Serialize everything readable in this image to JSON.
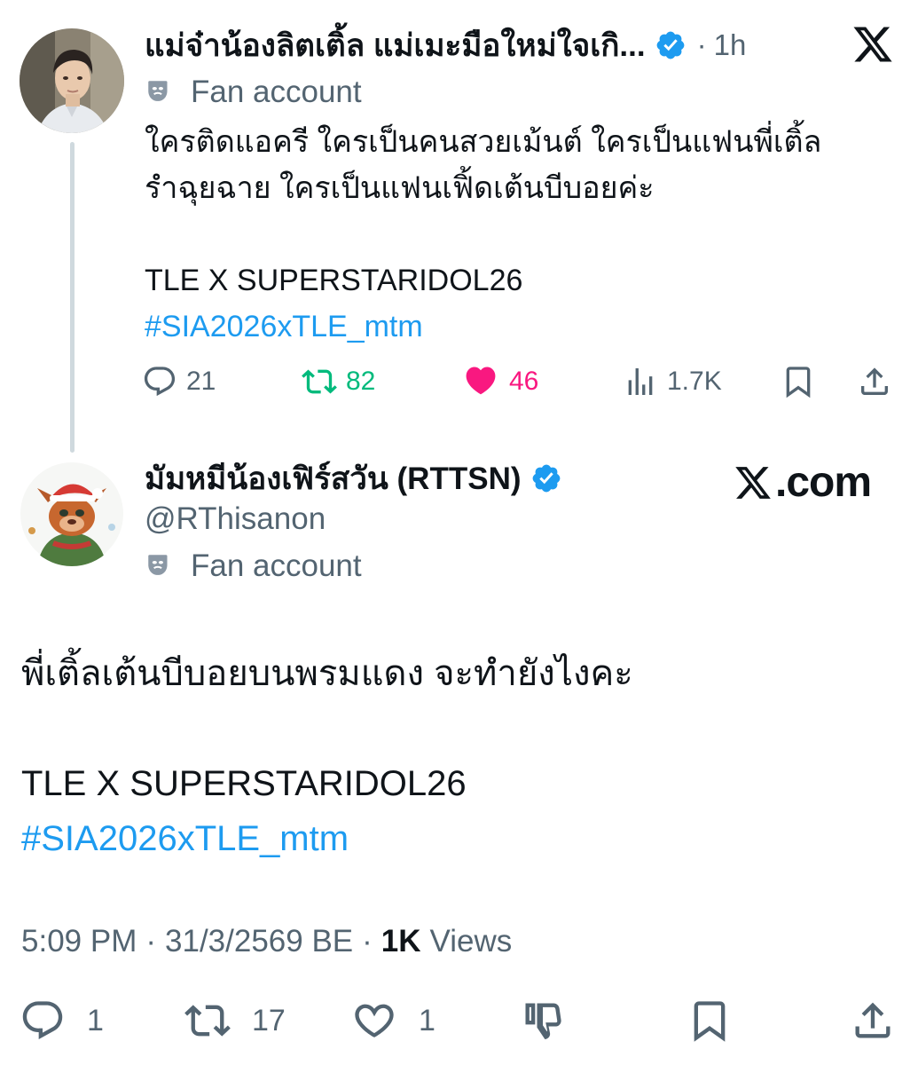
{
  "parent_tweet": {
    "display_name": "แม่จ๋าน้องลิตเติ้ล แม่เมะมือใหม่ใจเกิ...",
    "time_separator": "·",
    "relative_time": "1h",
    "account_label": "Fan account",
    "text_lines": [
      "ใครติดแอครี ใครเป็นคนสวยเม้นต์ ใครเป็นแฟนพี่เติ้ล",
      "รำฉุยฉาย ใครเป็นแฟนเฟิ้ดเต้นบีบอยค่ะ",
      "",
      "TLE X SUPERSTARIDOL26"
    ],
    "hashtag": "#SIA2026xTLE_mtm",
    "stats": {
      "replies": "21",
      "reposts": "82",
      "likes": "46",
      "views": "1.7K"
    }
  },
  "main_tweet": {
    "display_name": "มัมหมีน้องเฟิร์สวัน (RTTSN)",
    "handle": "@RThisanon",
    "account_label": "Fan account",
    "watermark": ".com",
    "text_lines": [
      "พี่เติ้ลเต้นบีบอยบนพรมแดง จะทำยังไงคะ",
      "",
      "TLE X SUPERSTARIDOL26"
    ],
    "hashtag": "#SIA2026xTLE_mtm",
    "time": "5:09 PM",
    "date": "31/3/2569 BE",
    "separator": "·",
    "views_count": "1K",
    "views_label": "Views",
    "stats": {
      "replies": "1",
      "reposts": "17",
      "likes": "1"
    }
  },
  "colors": {
    "verified": "#1d9bf0",
    "repost_active": "#00ba7c",
    "like_active": "#f91880",
    "link": "#1d9bf0",
    "secondary_text": "#536471"
  }
}
